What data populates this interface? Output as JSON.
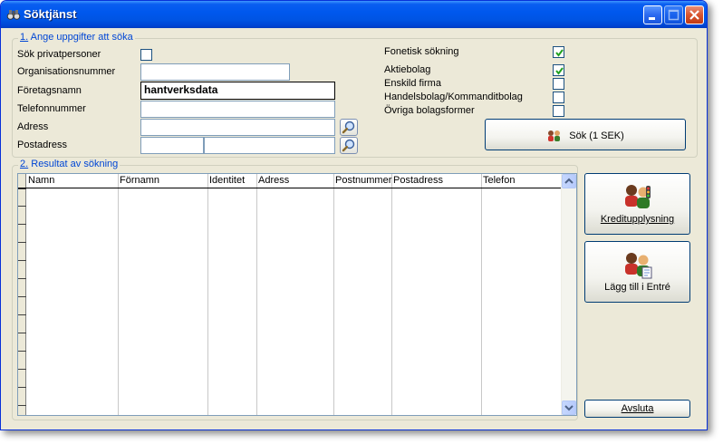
{
  "window": {
    "title": "Söktjänst"
  },
  "search_group": {
    "legend_num": "1.",
    "legend_text": "Ange uppgifter att söka",
    "labels": {
      "privat": "Sök privatpersoner",
      "orgnr": "Organisationsnummer",
      "foretag": "Företagsnamn",
      "telefon": "Telefonnummer",
      "adress": "Adress",
      "postadress": "Postadress"
    },
    "values": {
      "orgnr": "",
      "foretag": "hantverksdata",
      "telefon": "",
      "adress": "",
      "postnr": "",
      "postort": ""
    },
    "options": {
      "fonetisk": "Fonetisk sökning",
      "aktiebolag": "Aktiebolag",
      "enskild": "Enskild firma",
      "handelsbolag": "Handelsbolag/Kommanditbolag",
      "ovriga": "Övriga bolagsformer"
    },
    "search_button": "Sök (1 SEK)"
  },
  "result_group": {
    "legend_num": "2.",
    "legend_text": "Resultat av sökning",
    "columns": [
      "Namn",
      "Förnamn",
      "Identitet",
      "Adress",
      "Postnummer",
      "Postadress",
      "Telefon"
    ]
  },
  "actions": {
    "kredit": "Kreditupplysning",
    "entre": "Lägg till i Entré",
    "avsluta": "Avsluta"
  },
  "colors": {
    "accent": "#0046d5",
    "titlebar": "#0054e3"
  }
}
